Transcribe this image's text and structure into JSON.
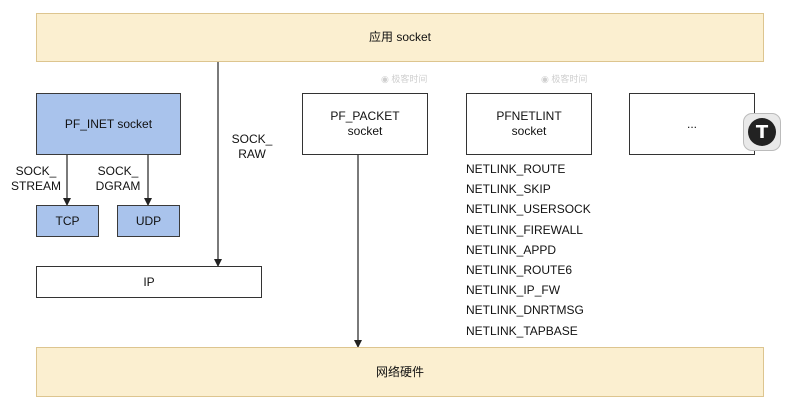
{
  "top_band": "应用 socket",
  "bottom_band": "网络硬件",
  "pf_inet": "PF_INET socket",
  "sock_stream": [
    "SOCK_",
    "STREAM"
  ],
  "sock_dgram": [
    "SOCK_",
    "DGRAM"
  ],
  "sock_raw": [
    "SOCK_",
    "RAW"
  ],
  "tcp": "TCP",
  "udp": "UDP",
  "ip": "IP",
  "pf_packet": [
    "PF_PACKET",
    "socket"
  ],
  "pf_netlink": [
    "PFNETLINT",
    "socket"
  ],
  "other": "...",
  "netlink_types": [
    "NETLINK_ROUTE",
    "NETLINK_SKIP",
    "NETLINK_USERSOCK",
    "NETLINK_FIREWALL",
    "NETLINK_APPD",
    "NETLINK_ROUTE6",
    "NETLINK_IP_FW",
    "NETLINK_DNRTMSG",
    "NETLINK_TAPBASE"
  ],
  "colors": {
    "band_fill": "#fbefd0",
    "pf_inet_fill": "#a9c3ec",
    "line": "#222222"
  }
}
